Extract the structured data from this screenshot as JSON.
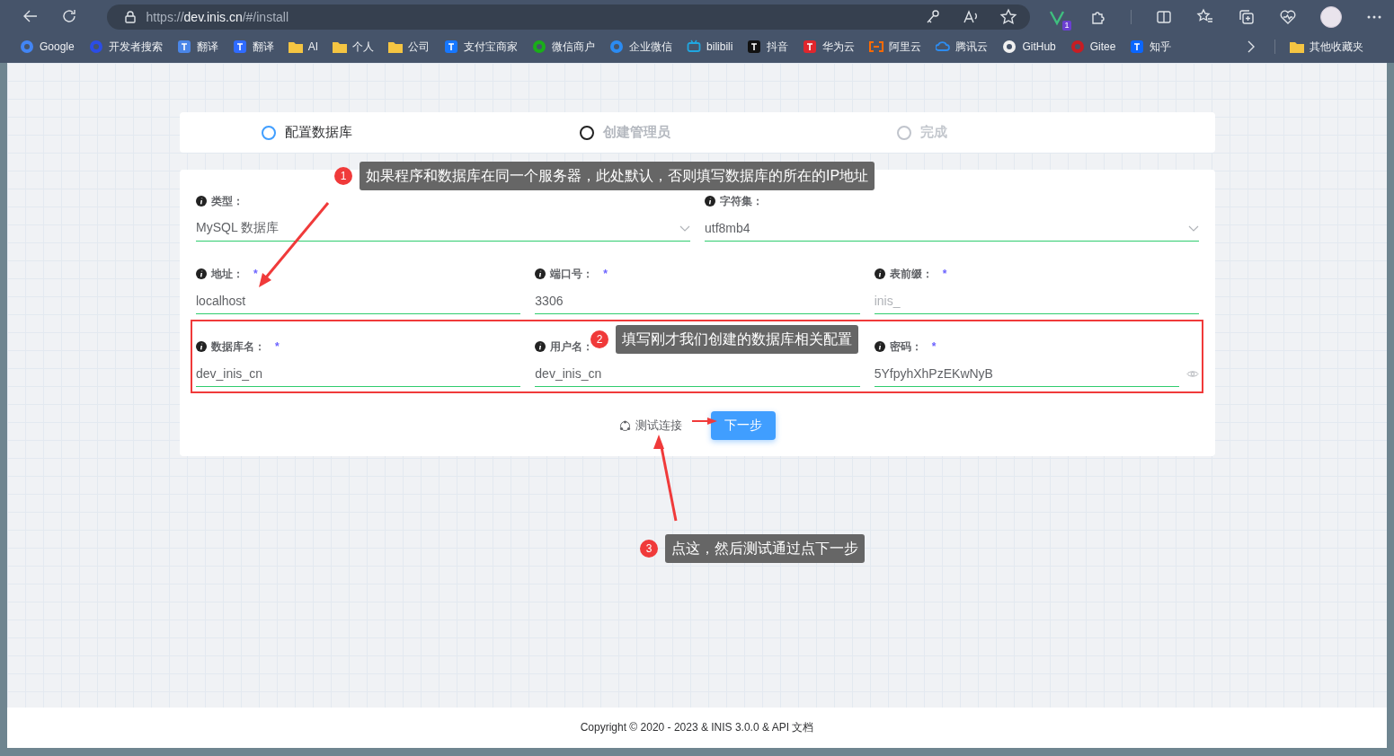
{
  "browser": {
    "url": {
      "scheme": "https://",
      "host": "dev.inis.cn",
      "path": "/#/install"
    },
    "extension_badge": "1",
    "bookmarks": [
      {
        "label": "Google"
      },
      {
        "label": "开发者搜索"
      },
      {
        "label": "翻译"
      },
      {
        "label": "翻译"
      },
      {
        "label": "AI"
      },
      {
        "label": "个人"
      },
      {
        "label": "公司"
      },
      {
        "label": "支付宝商家"
      },
      {
        "label": "微信商户"
      },
      {
        "label": "企业微信"
      },
      {
        "label": "bilibili"
      },
      {
        "label": "抖音"
      },
      {
        "label": "华为云"
      },
      {
        "label": "阿里云"
      },
      {
        "label": "腾讯云"
      },
      {
        "label": "GitHub"
      },
      {
        "label": "Gitee"
      },
      {
        "label": "知乎"
      }
    ],
    "other_bookmarks": "其他收藏夹"
  },
  "steps": [
    {
      "label": "配置数据库",
      "selected": true,
      "disabled": false
    },
    {
      "label": "创建管理员",
      "selected": false,
      "disabled": false
    },
    {
      "label": "完成",
      "selected": false,
      "disabled": true
    }
  ],
  "form": {
    "rows": [
      [
        {
          "kind": "select",
          "label": "类型：",
          "value": "MySQL 数据库"
        },
        {
          "kind": "select",
          "label": "字符集：",
          "value": "utf8mb4"
        }
      ],
      [
        {
          "kind": "text",
          "label": "地址：",
          "required_mark": "*",
          "value": "localhost"
        },
        {
          "kind": "text",
          "label": "端口号：",
          "required_mark": "*",
          "value": "3306"
        },
        {
          "kind": "text",
          "label": "表前缀：",
          "required_mark": "*",
          "placeholder": "inis_"
        }
      ],
      [
        {
          "kind": "text",
          "label": "数据库名：",
          "required_mark": "*",
          "value": "dev_inis_cn"
        },
        {
          "kind": "text",
          "label": "用户名：",
          "value": "dev_inis_cn"
        },
        {
          "kind": "password",
          "label": "密码：",
          "required_mark": "*",
          "value": "5YfpyhXhPzEKwNyB"
        }
      ]
    ],
    "test_button": "测试连接",
    "next_button": "下一步"
  },
  "callouts": [
    {
      "number": "1",
      "text": "如果程序和数据库在同一个服务器，此处默认，否则填写数据库的所在的IP地址"
    },
    {
      "number": "2",
      "text": "填写刚才我们创建的数据库相关配置"
    },
    {
      "number": "3",
      "text": "点这，然后测试通过点下一步"
    }
  ],
  "footer": "Copyright © 2020 - 2023 & INIS 3.0.0 & API 文档"
}
